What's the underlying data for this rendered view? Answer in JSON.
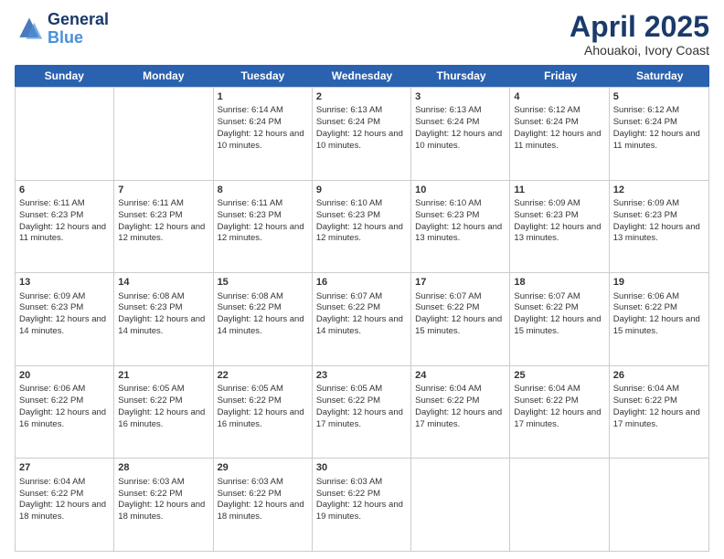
{
  "logo": {
    "line1": "General",
    "line2": "Blue"
  },
  "title": "April 2025",
  "subtitle": "Ahouakoi, Ivory Coast",
  "days": [
    "Sunday",
    "Monday",
    "Tuesday",
    "Wednesday",
    "Thursday",
    "Friday",
    "Saturday"
  ],
  "rows": [
    [
      {
        "day": "",
        "info": ""
      },
      {
        "day": "",
        "info": ""
      },
      {
        "day": "1",
        "info": "Sunrise: 6:14 AM\nSunset: 6:24 PM\nDaylight: 12 hours and 10 minutes."
      },
      {
        "day": "2",
        "info": "Sunrise: 6:13 AM\nSunset: 6:24 PM\nDaylight: 12 hours and 10 minutes."
      },
      {
        "day": "3",
        "info": "Sunrise: 6:13 AM\nSunset: 6:24 PM\nDaylight: 12 hours and 10 minutes."
      },
      {
        "day": "4",
        "info": "Sunrise: 6:12 AM\nSunset: 6:24 PM\nDaylight: 12 hours and 11 minutes."
      },
      {
        "day": "5",
        "info": "Sunrise: 6:12 AM\nSunset: 6:24 PM\nDaylight: 12 hours and 11 minutes."
      }
    ],
    [
      {
        "day": "6",
        "info": "Sunrise: 6:11 AM\nSunset: 6:23 PM\nDaylight: 12 hours and 11 minutes."
      },
      {
        "day": "7",
        "info": "Sunrise: 6:11 AM\nSunset: 6:23 PM\nDaylight: 12 hours and 12 minutes."
      },
      {
        "day": "8",
        "info": "Sunrise: 6:11 AM\nSunset: 6:23 PM\nDaylight: 12 hours and 12 minutes."
      },
      {
        "day": "9",
        "info": "Sunrise: 6:10 AM\nSunset: 6:23 PM\nDaylight: 12 hours and 12 minutes."
      },
      {
        "day": "10",
        "info": "Sunrise: 6:10 AM\nSunset: 6:23 PM\nDaylight: 12 hours and 13 minutes."
      },
      {
        "day": "11",
        "info": "Sunrise: 6:09 AM\nSunset: 6:23 PM\nDaylight: 12 hours and 13 minutes."
      },
      {
        "day": "12",
        "info": "Sunrise: 6:09 AM\nSunset: 6:23 PM\nDaylight: 12 hours and 13 minutes."
      }
    ],
    [
      {
        "day": "13",
        "info": "Sunrise: 6:09 AM\nSunset: 6:23 PM\nDaylight: 12 hours and 14 minutes."
      },
      {
        "day": "14",
        "info": "Sunrise: 6:08 AM\nSunset: 6:23 PM\nDaylight: 12 hours and 14 minutes."
      },
      {
        "day": "15",
        "info": "Sunrise: 6:08 AM\nSunset: 6:22 PM\nDaylight: 12 hours and 14 minutes."
      },
      {
        "day": "16",
        "info": "Sunrise: 6:07 AM\nSunset: 6:22 PM\nDaylight: 12 hours and 14 minutes."
      },
      {
        "day": "17",
        "info": "Sunrise: 6:07 AM\nSunset: 6:22 PM\nDaylight: 12 hours and 15 minutes."
      },
      {
        "day": "18",
        "info": "Sunrise: 6:07 AM\nSunset: 6:22 PM\nDaylight: 12 hours and 15 minutes."
      },
      {
        "day": "19",
        "info": "Sunrise: 6:06 AM\nSunset: 6:22 PM\nDaylight: 12 hours and 15 minutes."
      }
    ],
    [
      {
        "day": "20",
        "info": "Sunrise: 6:06 AM\nSunset: 6:22 PM\nDaylight: 12 hours and 16 minutes."
      },
      {
        "day": "21",
        "info": "Sunrise: 6:05 AM\nSunset: 6:22 PM\nDaylight: 12 hours and 16 minutes."
      },
      {
        "day": "22",
        "info": "Sunrise: 6:05 AM\nSunset: 6:22 PM\nDaylight: 12 hours and 16 minutes."
      },
      {
        "day": "23",
        "info": "Sunrise: 6:05 AM\nSunset: 6:22 PM\nDaylight: 12 hours and 17 minutes."
      },
      {
        "day": "24",
        "info": "Sunrise: 6:04 AM\nSunset: 6:22 PM\nDaylight: 12 hours and 17 minutes."
      },
      {
        "day": "25",
        "info": "Sunrise: 6:04 AM\nSunset: 6:22 PM\nDaylight: 12 hours and 17 minutes."
      },
      {
        "day": "26",
        "info": "Sunrise: 6:04 AM\nSunset: 6:22 PM\nDaylight: 12 hours and 17 minutes."
      }
    ],
    [
      {
        "day": "27",
        "info": "Sunrise: 6:04 AM\nSunset: 6:22 PM\nDaylight: 12 hours and 18 minutes."
      },
      {
        "day": "28",
        "info": "Sunrise: 6:03 AM\nSunset: 6:22 PM\nDaylight: 12 hours and 18 minutes."
      },
      {
        "day": "29",
        "info": "Sunrise: 6:03 AM\nSunset: 6:22 PM\nDaylight: 12 hours and 18 minutes."
      },
      {
        "day": "30",
        "info": "Sunrise: 6:03 AM\nSunset: 6:22 PM\nDaylight: 12 hours and 19 minutes."
      },
      {
        "day": "",
        "info": ""
      },
      {
        "day": "",
        "info": ""
      },
      {
        "day": "",
        "info": ""
      }
    ]
  ]
}
